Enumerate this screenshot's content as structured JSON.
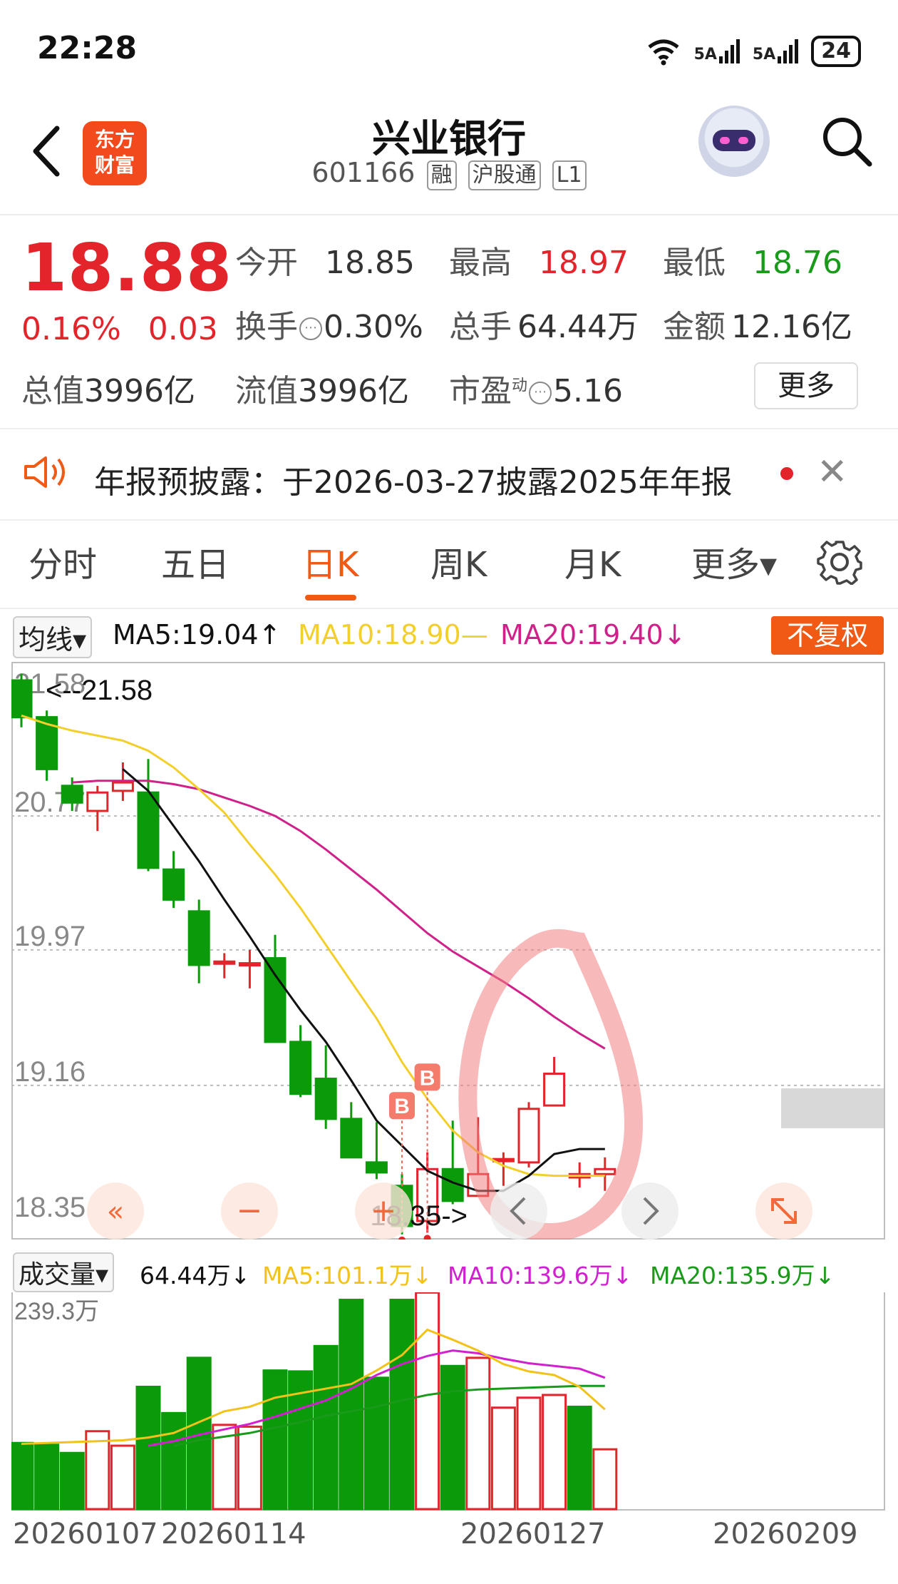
{
  "status_bar": {
    "time": "22:28",
    "signal_1": "5A",
    "signal_2": "5A",
    "battery": "24"
  },
  "header": {
    "stock_name": "兴业银行",
    "stock_code": "601166",
    "tags": [
      "融",
      "沪股通",
      "L1"
    ],
    "logo_line1": "东方",
    "logo_line2": "财富"
  },
  "quote": {
    "price": "18.88",
    "change_pct": "0.16%",
    "change_amt": "0.03",
    "open_label": "今开",
    "open": "18.85",
    "high_label": "最高",
    "high": "18.97",
    "low_label": "最低",
    "low": "18.76",
    "turnover_label": "换手",
    "turnover": "0.30%",
    "volume_label": "总手",
    "volume": "64.44万",
    "amount_label": "金额",
    "amount": "12.16亿",
    "mktcap_label": "总值",
    "mktcap": "3996亿",
    "float_label": "流值",
    "float_cap": "3996亿",
    "pe_label": "市盈",
    "pe_sup": "动",
    "pe": "5.16",
    "more_label": "更多"
  },
  "notice": {
    "text": "年报预披露：于2026-03-27披露2025年年报"
  },
  "tabs": [
    "分时",
    "五日",
    "日K",
    "周K",
    "月K",
    "更多▾"
  ],
  "active_tab": 2,
  "ma_legend": {
    "dropdown": "均线▾",
    "ma5": "MA5:19.04↑",
    "ma10": "MA10:18.90—",
    "ma20": "MA20:19.40↓",
    "adjust_button": "不复权"
  },
  "volume_legend": {
    "dropdown": "成交量▾",
    "vol": "64.44万↓",
    "ma5": "MA5:101.1万↓",
    "ma10": "MA10:139.6万↓",
    "ma20": "MA20:135.9万↓"
  },
  "colors": {
    "up": "#e4242b",
    "down": "#0a9a0a",
    "ma5": "#111111",
    "ma10": "#f2cf2a",
    "ma20": "#d0208a",
    "accent": "#f05a14"
  },
  "chart_data": {
    "type": "candlestick",
    "y_ticks": [
      "21.58",
      "20.77",
      "19.97",
      "19.16",
      "18.35"
    ],
    "ylim": [
      18.35,
      21.58
    ],
    "max_marker": "<--21.58",
    "min_marker": "18.35->",
    "buy_markers": [
      "B",
      "B"
    ],
    "candles": [
      {
        "o": 21.58,
        "c": 21.36,
        "h": 21.62,
        "l": 21.3
      },
      {
        "o": 21.36,
        "c": 21.05,
        "h": 21.4,
        "l": 20.98
      },
      {
        "o": 20.95,
        "c": 20.85,
        "h": 21.0,
        "l": 20.8
      },
      {
        "o": 20.8,
        "c": 20.91,
        "h": 20.95,
        "l": 20.68
      },
      {
        "o": 20.92,
        "c": 20.97,
        "h": 21.09,
        "l": 20.86
      },
      {
        "o": 20.91,
        "c": 20.46,
        "h": 21.11,
        "l": 20.44
      },
      {
        "o": 20.45,
        "c": 20.27,
        "h": 20.56,
        "l": 20.22
      },
      {
        "o": 20.2,
        "c": 19.88,
        "h": 20.27,
        "l": 19.77
      },
      {
        "o": 19.89,
        "c": 19.9,
        "h": 19.95,
        "l": 19.8
      },
      {
        "o": 19.88,
        "c": 19.89,
        "h": 19.97,
        "l": 19.74
      },
      {
        "o": 19.92,
        "c": 19.42,
        "h": 20.06,
        "l": 19.42
      },
      {
        "o": 19.42,
        "c": 19.11,
        "h": 19.52,
        "l": 19.09
      },
      {
        "o": 19.2,
        "c": 18.96,
        "h": 19.4,
        "l": 18.9
      },
      {
        "o": 18.96,
        "c": 18.73,
        "h": 19.06,
        "l": 18.73
      },
      {
        "o": 18.7,
        "c": 18.64,
        "h": 18.94,
        "l": 18.6
      },
      {
        "o": 18.56,
        "c": 18.32,
        "h": 18.63,
        "l": 18.27
      },
      {
        "o": 18.35,
        "c": 18.66,
        "h": 18.76,
        "l": 18.28
      },
      {
        "o": 18.66,
        "c": 18.47,
        "h": 18.95,
        "l": 18.45
      },
      {
        "o": 18.5,
        "c": 18.63,
        "h": 18.97,
        "l": 18.5
      },
      {
        "o": 18.71,
        "c": 18.72,
        "h": 18.76,
        "l": 18.56
      },
      {
        "o": 18.7,
        "c": 19.02,
        "h": 19.06,
        "l": 18.67
      },
      {
        "o": 19.04,
        "c": 19.23,
        "h": 19.33,
        "l": 19.04
      },
      {
        "o": 18.61,
        "c": 18.63,
        "h": 18.7,
        "l": 18.55
      },
      {
        "o": 18.63,
        "c": 18.66,
        "h": 18.73,
        "l": 18.53
      }
    ],
    "ma5": [
      null,
      null,
      null,
      null,
      21.05,
      20.92,
      20.71,
      20.5,
      20.27,
      20.05,
      19.82,
      19.61,
      19.42,
      19.19,
      18.95,
      18.8,
      18.65,
      18.58,
      18.53,
      18.53,
      18.62,
      18.75,
      18.78,
      18.78
    ],
    "ma10": [
      21.37,
      21.32,
      21.28,
      21.25,
      21.22,
      21.16,
      21.06,
      20.93,
      20.79,
      20.6,
      20.42,
      20.22,
      20.0,
      19.78,
      19.56,
      19.3,
      19.08,
      18.89,
      18.76,
      18.68,
      18.63,
      18.62,
      18.62,
      18.62
    ],
    "ma20": [
      null,
      null,
      20.97,
      20.98,
      20.98,
      20.98,
      20.96,
      20.93,
      20.88,
      20.83,
      20.77,
      20.68,
      20.57,
      20.45,
      20.33,
      20.2,
      20.07,
      19.96,
      19.87,
      19.78,
      19.68,
      19.57,
      19.47,
      19.38
    ],
    "volume_ylim_label": "239.3万",
    "volume_max": 239.3,
    "volumes": [
      73,
      71,
      62,
      86,
      70,
      135,
      106,
      167,
      93,
      91,
      153,
      152,
      180,
      231,
      145,
      231,
      239,
      158,
      167,
      112,
      123,
      126,
      113,
      66
    ],
    "vol_up": [
      false,
      false,
      false,
      true,
      true,
      false,
      false,
      false,
      true,
      true,
      false,
      false,
      false,
      false,
      false,
      false,
      true,
      false,
      true,
      true,
      true,
      true,
      false,
      true
    ],
    "vol_ma5": [
      72,
      73,
      74,
      75,
      76,
      79,
      84,
      96,
      108,
      113,
      123,
      128,
      133,
      138,
      153,
      170,
      198,
      187,
      175,
      160,
      152,
      148,
      135,
      110
    ],
    "vol_ma10": [
      null,
      null,
      null,
      null,
      null,
      70,
      75,
      82,
      88,
      94,
      102,
      111,
      120,
      133,
      148,
      160,
      169,
      175,
      172,
      166,
      161,
      158,
      155,
      145
    ],
    "vol_ma20": [
      null,
      null,
      null,
      null,
      null,
      null,
      70,
      76,
      80,
      84,
      90,
      96,
      103,
      108,
      113,
      120,
      126,
      130,
      132,
      133,
      134,
      135,
      136,
      136
    ],
    "x_labels": [
      "20260107",
      "20260114",
      "20260127",
      "20260209"
    ]
  }
}
